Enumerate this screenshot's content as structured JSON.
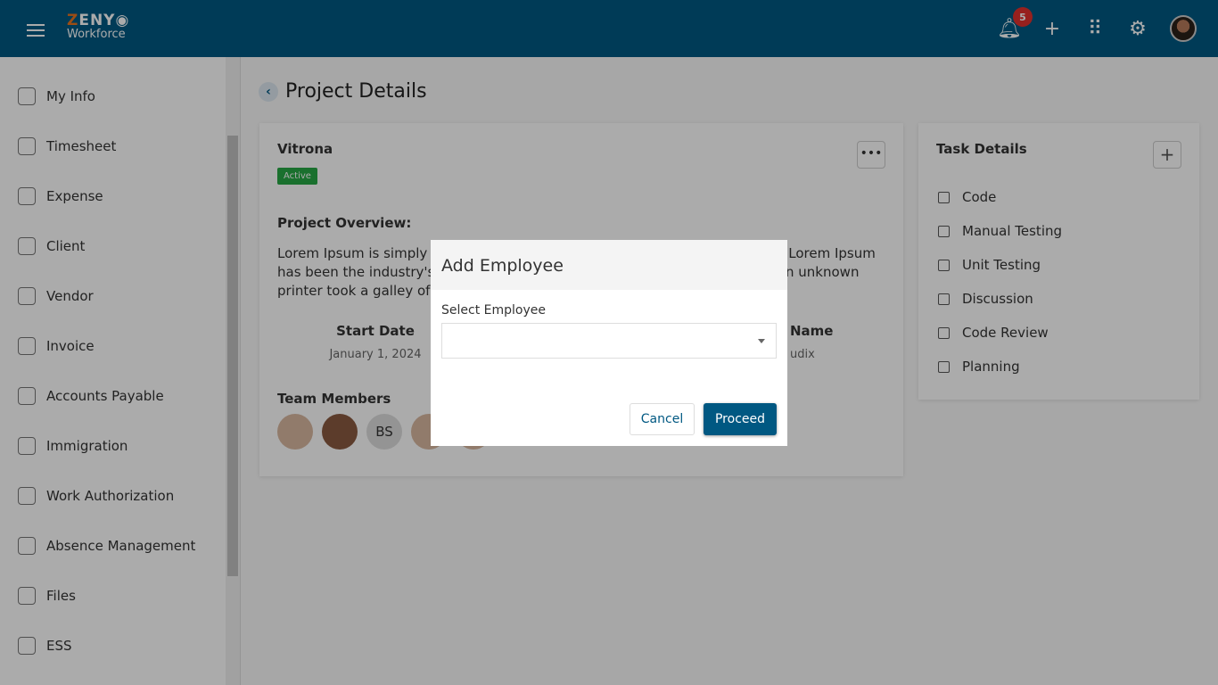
{
  "header": {
    "logo_top": "ZENY",
    "logo_bottom": "Workforce",
    "notifications": "5",
    "icons": [
      "menu-icon",
      "bell-icon",
      "plus-icon",
      "apps-grid-icon",
      "gear-icon",
      "user-avatar"
    ]
  },
  "sidebar": {
    "items": [
      {
        "label": "My Info"
      },
      {
        "label": "Timesheet"
      },
      {
        "label": "Expense"
      },
      {
        "label": "Client"
      },
      {
        "label": "Vendor"
      },
      {
        "label": "Invoice"
      },
      {
        "label": "Accounts Payable"
      },
      {
        "label": "Immigration"
      },
      {
        "label": "Work Authorization"
      },
      {
        "label": "Absence Management"
      },
      {
        "label": "Files"
      },
      {
        "label": "ESS"
      }
    ]
  },
  "page": {
    "title": "Project Details"
  },
  "project": {
    "name": "Vitrona",
    "status": "Active",
    "overview_label": "Project Overview:",
    "overview": "Lorem Ipsum is simply dummy text of the printing and typesetting industry. Lorem Ipsum has been the industry's standard dummy text ever since the 1500s, when an unknown printer took a galley of type a",
    "start_label": "Start Date",
    "start_value": "January 1, 2024",
    "name_label": "Name",
    "name_value": "udix",
    "team_label": "Team Members",
    "members": [
      "",
      "",
      "BS",
      "",
      ""
    ]
  },
  "tasks": {
    "title": "Task Details",
    "items": [
      "Code",
      "Manual Testing",
      "Unit Testing",
      "Discussion",
      "Code Review",
      "Planning"
    ]
  },
  "modal": {
    "title": "Add Employee",
    "label": "Select Employee",
    "value": "",
    "cancel": "Cancel",
    "proceed": "Proceed"
  },
  "colors": {
    "brand": "#005882",
    "active": "#28a745",
    "badge": "#e2312d"
  }
}
